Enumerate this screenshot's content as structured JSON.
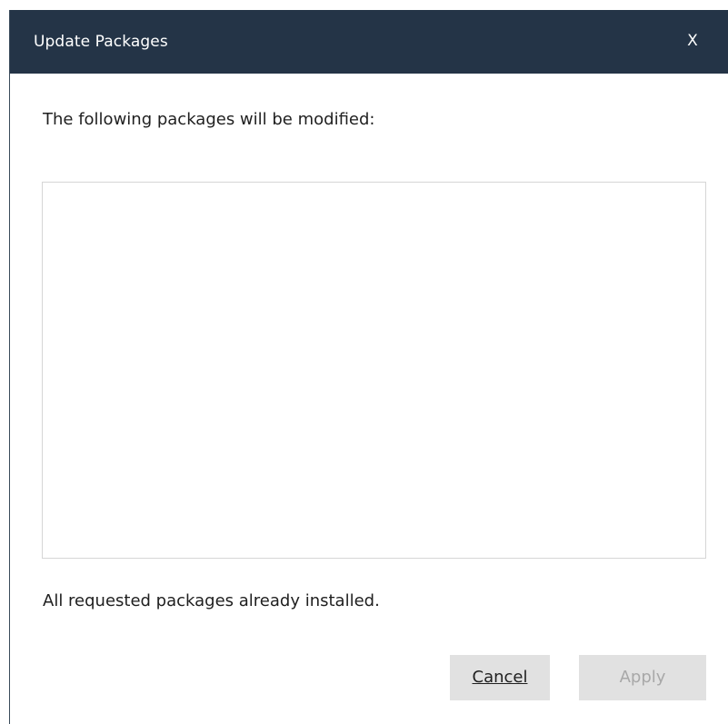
{
  "dialog": {
    "title": "Update Packages",
    "close_label": "X",
    "message": "The following packages will be modified:",
    "packages": [],
    "status": "All requested packages already installed.",
    "buttons": {
      "cancel_label": "Cancel",
      "apply_label": "Apply",
      "apply_enabled": false
    }
  },
  "colors": {
    "titlebar": "#243447",
    "button_bg": "#e1e1e1",
    "disabled_text": "#a8a8a8"
  }
}
